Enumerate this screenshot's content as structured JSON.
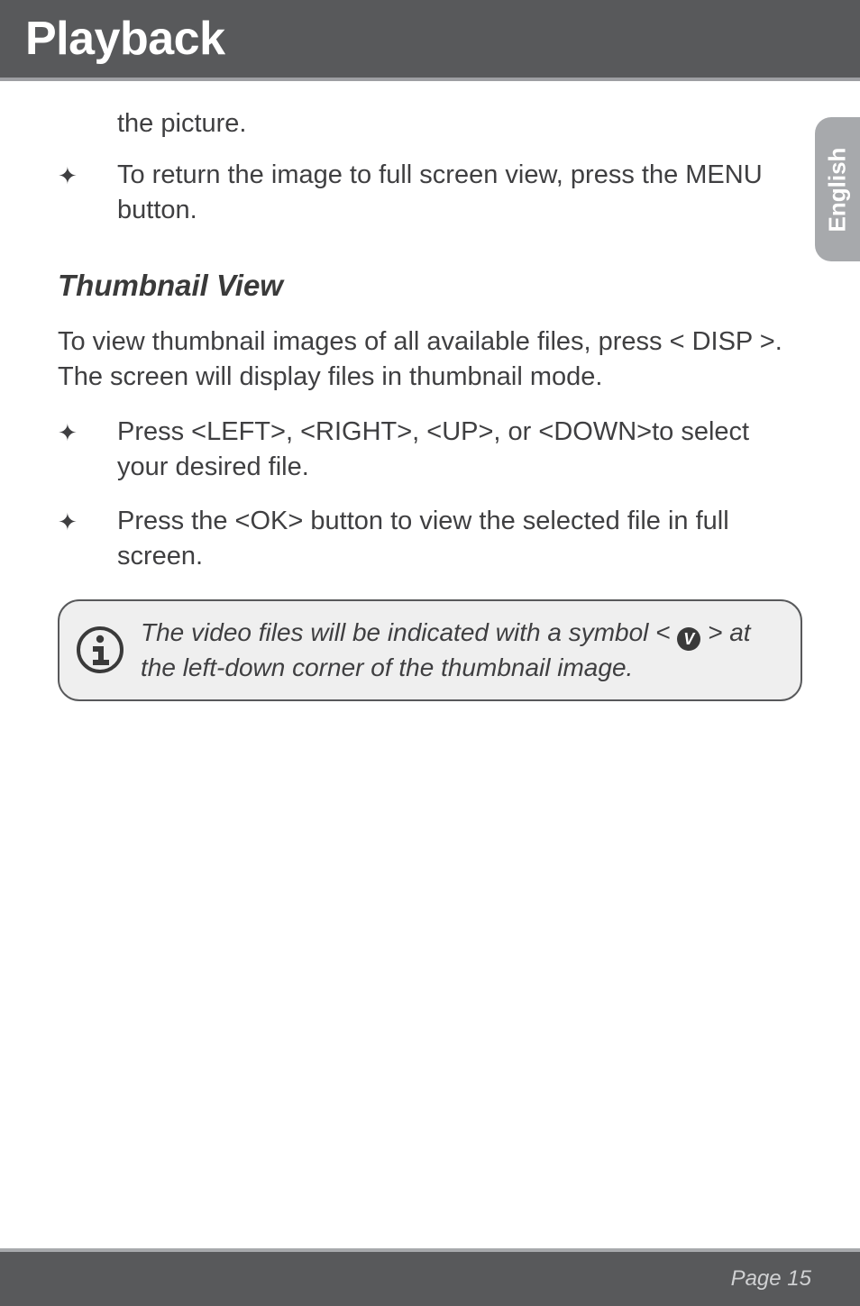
{
  "header": {
    "title": "Playback"
  },
  "side_tab": {
    "label": "English"
  },
  "body": {
    "continued": "the picture.",
    "bullets_top": [
      "To return the image to full screen view, press the MENU button."
    ],
    "subhead": "Thumbnail View",
    "intro": "To view thumbnail images of all available files, press < DISP >. The screen will display files in thumbnail mode.",
    "bullets_main": [
      "Press <LEFT>, <RIGHT>, <UP>, or <DOWN>to select your desired file.",
      "Press the <OK> button to view the selected file in full screen."
    ]
  },
  "callout": {
    "part1": "The video files will be indicated with a symbol < ",
    "badge": "V",
    "part2": " > at  the left-down corner of the thumbnail image."
  },
  "footer": {
    "page_label": "Page 15"
  }
}
